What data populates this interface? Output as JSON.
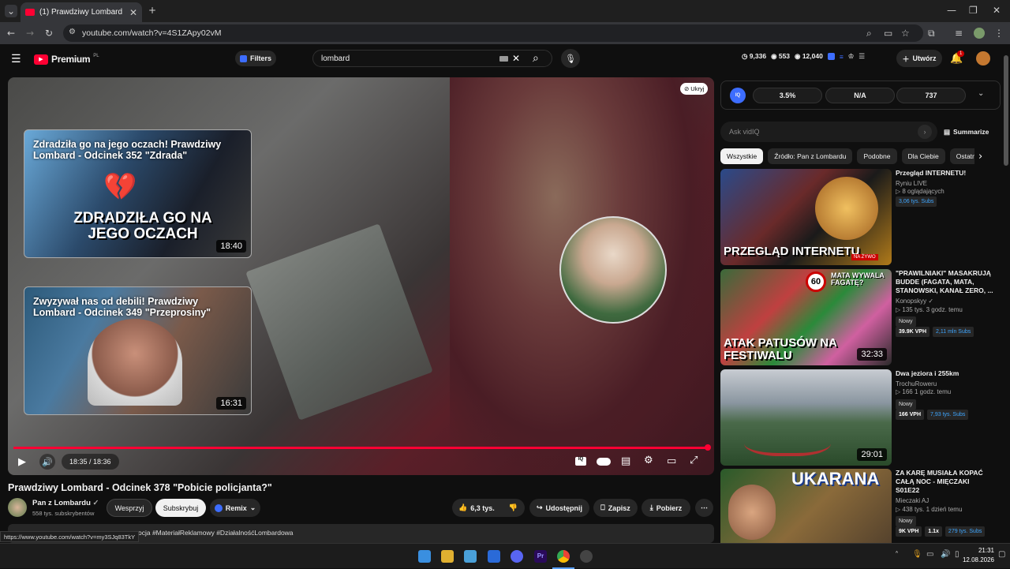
{
  "browser": {
    "tab_title": "(1) Prawdziwy Lombard - Odcin",
    "url": "youtube.com/watch?v=4S1ZApy02vM",
    "status_url": "https://www.youtube.com/watch?v=my3SJq83TkY"
  },
  "header": {
    "brand": "Premium",
    "brand_sup": "PL",
    "filters": "Filters",
    "search_value": "lombard",
    "stats": [
      "9,336",
      "553",
      "12,040"
    ],
    "create": "Utwórz",
    "notif_count": "1"
  },
  "player": {
    "hide_label": "Ukryj",
    "time": "18:35 / 18:36",
    "progress": 0.999,
    "endcards": [
      {
        "title": "Zdradziła go na jego oczach! Prawdziwy Lombard - Odcinek 352 \"Zdrada\"",
        "overlay": "ZDRADZIŁA GO NA JEGO OCZACH",
        "duration": "18:40"
      },
      {
        "title": "Zwyzywał nas od debili! Prawdziwy Lombard - Odcinek 349 \"Przeprosiny\"",
        "duration": "16:31"
      }
    ]
  },
  "video": {
    "title": "Prawdziwy Lombard - Odcinek 378 \"Pobicie policjanta?\"",
    "channel": "Pan z Lombardu",
    "subs": "558 tys. subskrybentów",
    "support": "Wesprzyj",
    "subscribe": "Subskrybuj",
    "remix": "Remix",
    "likes": "6,3 tys.",
    "share": "Udostępnij",
    "save": "Zapisz",
    "download": "Pobierz",
    "desc_tags": "ocja #MateriałReklamowy #DziałalnośćLombardowa"
  },
  "vidiq": {
    "stats": [
      "3.5%",
      "N/A",
      "737"
    ],
    "ask_placeholder": "Ask vidIQ",
    "summarize": "Summarize"
  },
  "chips": [
    "Wszystkie",
    "Źródło: Pan z Lombardu",
    "Podobne",
    "Dla Ciebie",
    "Ostatnio"
  ],
  "recs": [
    {
      "title": "Przegląd INTERNETU!",
      "channel": "Ryniu LIVE",
      "line": "8 oglądających",
      "subs": "3,06 tys. Subs",
      "overlay": "PRZEGLĄD INTERNETU",
      "live": "NA ŻYWO"
    },
    {
      "title": "\"PRAWILNIAKI\" MASAKRUJĄ BUDDE (FAGATA, MATA, STANOWSKI, KANAŁ ZERO, ...",
      "channel": "Konopskyy",
      "line": "135 tys.  3 godz. temu",
      "badge": "Nowy",
      "vph": "39.9K VPH",
      "subs": "2,11 mln Subs",
      "duration": "32:33",
      "overlay": "ATAK PATUSÓW NA FESTIWALU",
      "overlay2": "MATA WYWALA FAGATĘ?",
      "sign": "60"
    },
    {
      "title": "Dwa jeziora i 255km",
      "channel": "TrochuRoweru",
      "line": "166  1 godz. temu",
      "badge": "Nowy",
      "vph": "166 VPH",
      "subs": "7,93 tys. Subs",
      "duration": "29:01"
    },
    {
      "title": "ZA KARĘ MUSIAŁA KOPAĆ CAŁĄ NOC - MIĘCZAKI S01E22",
      "channel": "Mieczaki AJ",
      "line": "438 tys.  1 dzień temu",
      "badge": "Nowy",
      "vph": "9K VPH",
      "x": "1.1x",
      "subs": "279 tys. Subs",
      "overlay": "UKARANA"
    }
  ],
  "taskbar": {
    "time": "21:31",
    "date": "12.08.2026"
  }
}
